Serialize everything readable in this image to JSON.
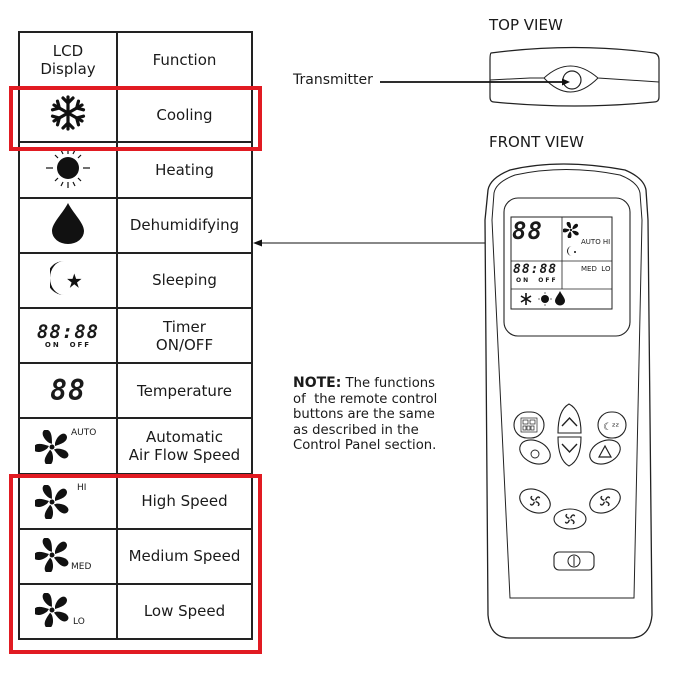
{
  "table": {
    "headers": {
      "lcd": "LCD\nDisplay",
      "lcd_line1": "LCD",
      "lcd_line2": "Display",
      "function": "Function"
    },
    "rows": [
      {
        "icon": "snowflake-icon",
        "function": "Cooling",
        "highlighted": true
      },
      {
        "icon": "sun-icon",
        "function": "Heating",
        "highlighted": false
      },
      {
        "icon": "water-drop-icon",
        "function": "Dehumidifying",
        "highlighted": false
      },
      {
        "icon": "moon-star-icon",
        "function": "Sleeping",
        "highlighted": false
      },
      {
        "icon": "timer-display-icon",
        "function_line1": "Timer",
        "function_line2": "ON/OFF",
        "lcd_text": "88:88",
        "lcd_sub": "ON  OFF",
        "highlighted": false
      },
      {
        "icon": "temperature-digits-icon",
        "function": "Temperature",
        "lcd_text": "88",
        "highlighted": false
      },
      {
        "icon": "fan-auto-icon",
        "function_line1": "Automatic",
        "function_line2": "Air Flow Speed",
        "lcd_label": "AUTO",
        "highlighted": false
      },
      {
        "icon": "fan-hi-icon",
        "function": "High Speed",
        "lcd_label": "HI",
        "highlighted": true
      },
      {
        "icon": "fan-med-icon",
        "function": "Medium Speed",
        "lcd_label": "MED",
        "highlighted": true
      },
      {
        "icon": "fan-lo-icon",
        "function": "Low Speed",
        "lcd_label": "LO",
        "highlighted": true
      }
    ]
  },
  "labels": {
    "top_view": "TOP VIEW",
    "front_view": "FRONT VIEW",
    "transmitter": "Transmitter"
  },
  "note": {
    "prefix": "NOTE:",
    "line1": " The functions",
    "line2": "of  the remote control",
    "line3": "buttons are the same",
    "line4": "as described in the",
    "line5": "Control Panel section."
  },
  "remote_lcd": {
    "temp": "88",
    "timer": "88:88",
    "timer_sub": "ON  OFF",
    "fan_labels_1": "AUTO HI",
    "fan_labels_2": "MED  LO"
  },
  "colors": {
    "highlight": "#e11b22",
    "ink": "#1a1a1a"
  }
}
